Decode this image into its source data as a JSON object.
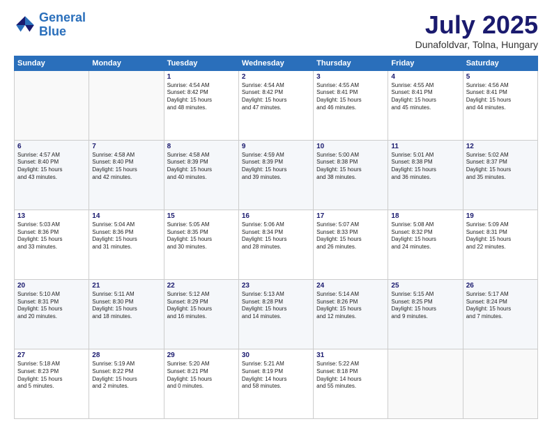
{
  "logo": {
    "line1": "General",
    "line2": "Blue"
  },
  "title": "July 2025",
  "subtitle": "Dunafoldvar, Tolna, Hungary",
  "header_days": [
    "Sunday",
    "Monday",
    "Tuesday",
    "Wednesday",
    "Thursday",
    "Friday",
    "Saturday"
  ],
  "weeks": [
    [
      {
        "day": "",
        "info": ""
      },
      {
        "day": "",
        "info": ""
      },
      {
        "day": "1",
        "info": "Sunrise: 4:54 AM\nSunset: 8:42 PM\nDaylight: 15 hours\nand 48 minutes."
      },
      {
        "day": "2",
        "info": "Sunrise: 4:54 AM\nSunset: 8:42 PM\nDaylight: 15 hours\nand 47 minutes."
      },
      {
        "day": "3",
        "info": "Sunrise: 4:55 AM\nSunset: 8:41 PM\nDaylight: 15 hours\nand 46 minutes."
      },
      {
        "day": "4",
        "info": "Sunrise: 4:55 AM\nSunset: 8:41 PM\nDaylight: 15 hours\nand 45 minutes."
      },
      {
        "day": "5",
        "info": "Sunrise: 4:56 AM\nSunset: 8:41 PM\nDaylight: 15 hours\nand 44 minutes."
      }
    ],
    [
      {
        "day": "6",
        "info": "Sunrise: 4:57 AM\nSunset: 8:40 PM\nDaylight: 15 hours\nand 43 minutes."
      },
      {
        "day": "7",
        "info": "Sunrise: 4:58 AM\nSunset: 8:40 PM\nDaylight: 15 hours\nand 42 minutes."
      },
      {
        "day": "8",
        "info": "Sunrise: 4:58 AM\nSunset: 8:39 PM\nDaylight: 15 hours\nand 40 minutes."
      },
      {
        "day": "9",
        "info": "Sunrise: 4:59 AM\nSunset: 8:39 PM\nDaylight: 15 hours\nand 39 minutes."
      },
      {
        "day": "10",
        "info": "Sunrise: 5:00 AM\nSunset: 8:38 PM\nDaylight: 15 hours\nand 38 minutes."
      },
      {
        "day": "11",
        "info": "Sunrise: 5:01 AM\nSunset: 8:38 PM\nDaylight: 15 hours\nand 36 minutes."
      },
      {
        "day": "12",
        "info": "Sunrise: 5:02 AM\nSunset: 8:37 PM\nDaylight: 15 hours\nand 35 minutes."
      }
    ],
    [
      {
        "day": "13",
        "info": "Sunrise: 5:03 AM\nSunset: 8:36 PM\nDaylight: 15 hours\nand 33 minutes."
      },
      {
        "day": "14",
        "info": "Sunrise: 5:04 AM\nSunset: 8:36 PM\nDaylight: 15 hours\nand 31 minutes."
      },
      {
        "day": "15",
        "info": "Sunrise: 5:05 AM\nSunset: 8:35 PM\nDaylight: 15 hours\nand 30 minutes."
      },
      {
        "day": "16",
        "info": "Sunrise: 5:06 AM\nSunset: 8:34 PM\nDaylight: 15 hours\nand 28 minutes."
      },
      {
        "day": "17",
        "info": "Sunrise: 5:07 AM\nSunset: 8:33 PM\nDaylight: 15 hours\nand 26 minutes."
      },
      {
        "day": "18",
        "info": "Sunrise: 5:08 AM\nSunset: 8:32 PM\nDaylight: 15 hours\nand 24 minutes."
      },
      {
        "day": "19",
        "info": "Sunrise: 5:09 AM\nSunset: 8:31 PM\nDaylight: 15 hours\nand 22 minutes."
      }
    ],
    [
      {
        "day": "20",
        "info": "Sunrise: 5:10 AM\nSunset: 8:31 PM\nDaylight: 15 hours\nand 20 minutes."
      },
      {
        "day": "21",
        "info": "Sunrise: 5:11 AM\nSunset: 8:30 PM\nDaylight: 15 hours\nand 18 minutes."
      },
      {
        "day": "22",
        "info": "Sunrise: 5:12 AM\nSunset: 8:29 PM\nDaylight: 15 hours\nand 16 minutes."
      },
      {
        "day": "23",
        "info": "Sunrise: 5:13 AM\nSunset: 8:28 PM\nDaylight: 15 hours\nand 14 minutes."
      },
      {
        "day": "24",
        "info": "Sunrise: 5:14 AM\nSunset: 8:26 PM\nDaylight: 15 hours\nand 12 minutes."
      },
      {
        "day": "25",
        "info": "Sunrise: 5:15 AM\nSunset: 8:25 PM\nDaylight: 15 hours\nand 9 minutes."
      },
      {
        "day": "26",
        "info": "Sunrise: 5:17 AM\nSunset: 8:24 PM\nDaylight: 15 hours\nand 7 minutes."
      }
    ],
    [
      {
        "day": "27",
        "info": "Sunrise: 5:18 AM\nSunset: 8:23 PM\nDaylight: 15 hours\nand 5 minutes."
      },
      {
        "day": "28",
        "info": "Sunrise: 5:19 AM\nSunset: 8:22 PM\nDaylight: 15 hours\nand 2 minutes."
      },
      {
        "day": "29",
        "info": "Sunrise: 5:20 AM\nSunset: 8:21 PM\nDaylight: 15 hours\nand 0 minutes."
      },
      {
        "day": "30",
        "info": "Sunrise: 5:21 AM\nSunset: 8:19 PM\nDaylight: 14 hours\nand 58 minutes."
      },
      {
        "day": "31",
        "info": "Sunrise: 5:22 AM\nSunset: 8:18 PM\nDaylight: 14 hours\nand 55 minutes."
      },
      {
        "day": "",
        "info": ""
      },
      {
        "day": "",
        "info": ""
      }
    ]
  ]
}
